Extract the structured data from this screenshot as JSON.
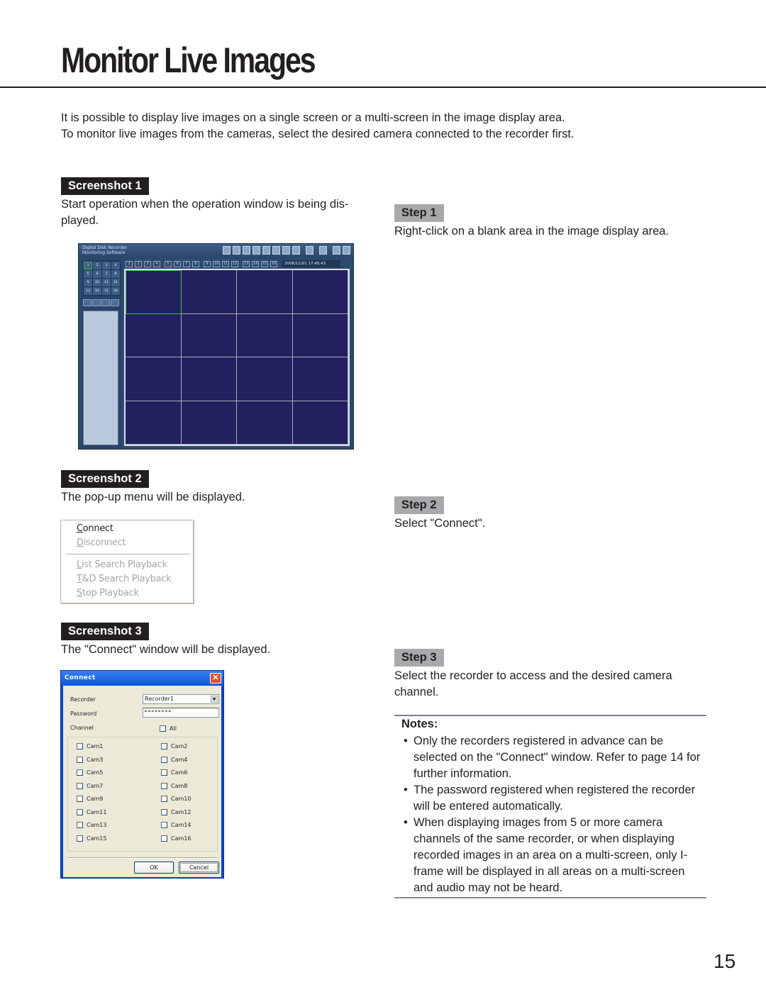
{
  "page": {
    "title": "Monitor Live Images",
    "intro": [
      "It is possible to display live images on a single screen or a multi-screen in the image display area.",
      "To monitor live images from the cameras, select the desired camera connected to the recorder first."
    ],
    "page_number": "15"
  },
  "screenshot1": {
    "label": "Screenshot 1",
    "caption": "Start operation when the operation window is being dis-played.",
    "caption_line1": "Start operation when the operation window is being dis-",
    "caption_line2": "played.",
    "app": {
      "title_line1": "Digital Disk Recorder",
      "title_line2": "Monitoring Software",
      "camera_buttons": [
        "1",
        "2",
        "3",
        "4",
        "5",
        "6",
        "7",
        "8",
        "9",
        "10",
        "11",
        "12",
        "13",
        "14",
        "15",
        "16"
      ],
      "selected_camera": "1",
      "channel_buttons": [
        "1",
        "2",
        "3",
        "4",
        "5",
        "6",
        "7",
        "8",
        "9",
        "10",
        "11",
        "12",
        "13",
        "14",
        "15",
        "16"
      ],
      "clock": "2006/11/01  17:48:43",
      "layout": "4x4 multi-screen"
    }
  },
  "step1": {
    "label": "Step 1",
    "text": "Right-click on a blank area in the image display area."
  },
  "screenshot2": {
    "label": "Screenshot 2",
    "caption": "The pop-up menu will be displayed.",
    "menu": [
      {
        "mnemonic": "C",
        "rest": "onnect",
        "label": "Connect",
        "enabled": true
      },
      {
        "mnemonic": "D",
        "rest": "isconnect",
        "label": "Disconnect",
        "enabled": false
      },
      {
        "mnemonic": "L",
        "rest": "ist Search Playback",
        "label": "List Search Playback",
        "enabled": false
      },
      {
        "mnemonic": "T",
        "rest": "&D Search Playback",
        "label": "T&D Search Playback",
        "enabled": false
      },
      {
        "mnemonic": "S",
        "rest": "top Playback",
        "label": "Stop Playback",
        "enabled": false
      }
    ]
  },
  "step2": {
    "label": "Step 2",
    "text": "Select \"Connect\"."
  },
  "screenshot3": {
    "label": "Screenshot 3",
    "caption": "The \"Connect\" window will be displayed.",
    "dialog": {
      "title": "Connect",
      "close_glyph": "✕",
      "recorder_label": "Recorder",
      "recorder_value": "Recorder1",
      "password_label": "Password",
      "password_value": "********",
      "channel_label": "Channel",
      "all_label": "All",
      "cameras": [
        "Cam1",
        "Cam2",
        "Cam3",
        "Cam4",
        "Cam5",
        "Cam6",
        "Cam7",
        "Cam8",
        "Cam9",
        "Cam10",
        "Cam11",
        "Cam12",
        "Cam13",
        "Cam14",
        "Cam15",
        "Cam16"
      ],
      "ok_label": "OK",
      "cancel_label": "Cancel"
    }
  },
  "step3": {
    "label": "Step 3",
    "text_line1": "Select the recorder to access and the desired camera",
    "text_line2": "channel."
  },
  "notes": {
    "title": "Notes:",
    "items": [
      "Only the recorders registered in advance can be selected on the \"Connect\" window. Refer to page 14 for further information.",
      "The password registered when registered the recorder will be entered automatically.",
      "When displaying images from 5 or more camera channels of the same recorder, or when displaying recorded images in an area on a multi-screen, only I-frame will be displayed in all areas on a multi-screen and audio may not be heard."
    ]
  }
}
